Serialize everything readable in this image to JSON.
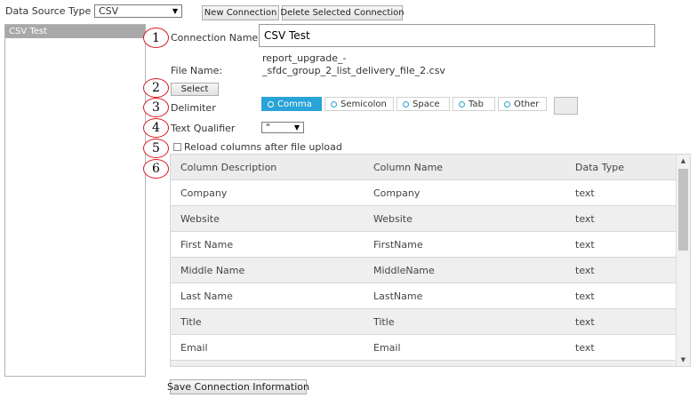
{
  "header": {
    "data_source_label": "Data Source Type",
    "data_source_value": "CSV",
    "new_connection": "New Connection",
    "delete_connection": "Delete Selected Connection"
  },
  "connections": [
    "CSV Test"
  ],
  "steps": [
    "1",
    "2",
    "3",
    "4",
    "5",
    "6"
  ],
  "form": {
    "connection_name_label": "Connection Name",
    "connection_name_value": "CSV Test",
    "file_name_label": "File Name:",
    "file_name_line1": "report_upgrade_-",
    "file_name_line2": "_sfdc_group_2_list_delivery_file_2.csv",
    "select_button": "Select",
    "delimiter_label": "Delimiter",
    "delimiters": [
      "Comma",
      "Semicolon",
      "Space",
      "Tab",
      "Other"
    ],
    "delimiter_selected": "Comma",
    "text_qualifier_label": "Text Qualifier",
    "text_qualifier_value": "\"",
    "reload_label": "Reload columns after file upload"
  },
  "table": {
    "headers": [
      "Column Description",
      "Column Name",
      "Data Type"
    ],
    "rows": [
      [
        "Company",
        "Company",
        "text"
      ],
      [
        "Website",
        "Website",
        "text"
      ],
      [
        "First Name",
        "FirstName",
        "text"
      ],
      [
        "Middle Name",
        "MiddleName",
        "text"
      ],
      [
        "Last Name",
        "LastName",
        "text"
      ],
      [
        "Title",
        "Title",
        "text"
      ],
      [
        "Email",
        "Email",
        "text"
      ]
    ]
  },
  "footer": {
    "save_button": "Save Connection Information"
  },
  "colors": {
    "accent": "#29a3d8",
    "step_circle": "#d71920",
    "selected_item": "#a8a8a8"
  }
}
